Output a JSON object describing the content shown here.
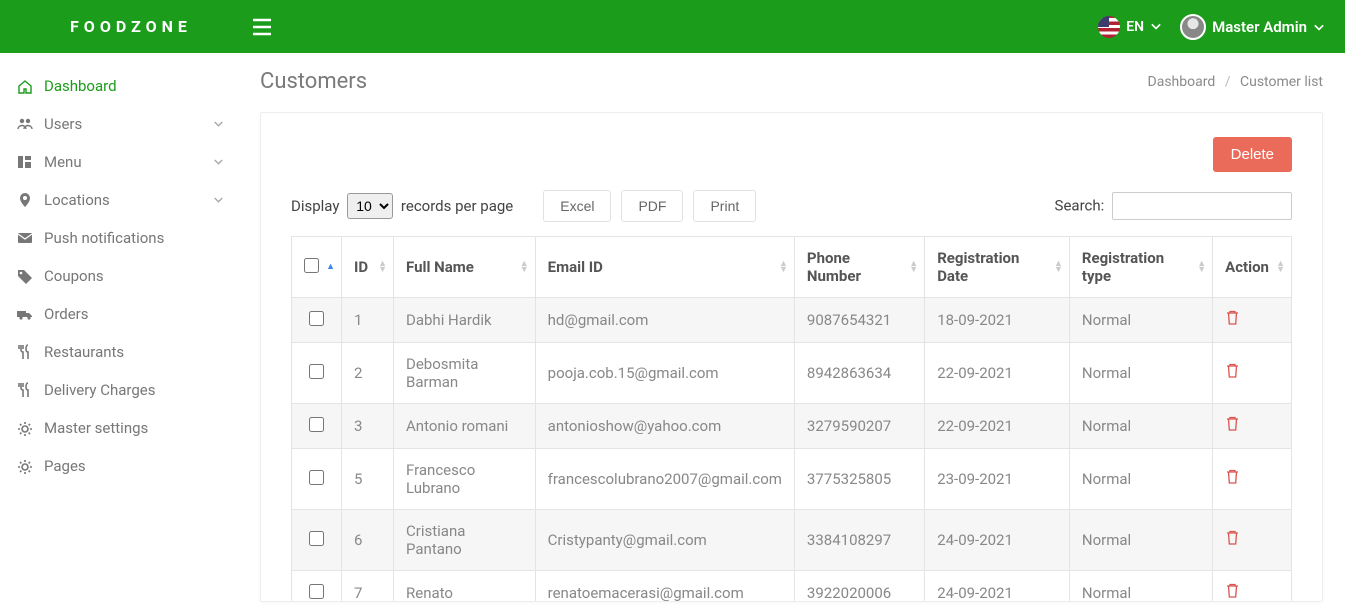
{
  "brand": "FOODZONE",
  "header": {
    "language": "EN",
    "user": "Master Admin"
  },
  "sidebar": {
    "items": [
      {
        "label": "Dashboard",
        "icon": "home",
        "active": true,
        "expandable": false
      },
      {
        "label": "Users",
        "icon": "users",
        "expandable": true
      },
      {
        "label": "Menu",
        "icon": "menu",
        "expandable": true
      },
      {
        "label": "Locations",
        "icon": "pin",
        "expandable": true
      },
      {
        "label": "Push notifications",
        "icon": "mail",
        "expandable": false
      },
      {
        "label": "Coupons",
        "icon": "tag",
        "expandable": false
      },
      {
        "label": "Orders",
        "icon": "truck",
        "expandable": false
      },
      {
        "label": "Restaurants",
        "icon": "fork",
        "expandable": false
      },
      {
        "label": "Delivery Charges",
        "icon": "fork",
        "expandable": false
      },
      {
        "label": "Master settings",
        "icon": "gear",
        "expandable": false
      },
      {
        "label": "Pages",
        "icon": "gear",
        "expandable": false
      }
    ]
  },
  "page": {
    "title": "Customers",
    "breadcrumb": {
      "root": "Dashboard",
      "current": "Customer list"
    }
  },
  "toolbar": {
    "delete": "Delete",
    "display_prefix": "Display",
    "display_suffix": "records per page",
    "page_size": "10",
    "excel": "Excel",
    "pdf": "PDF",
    "print": "Print",
    "search_label": "Search:"
  },
  "table": {
    "columns": {
      "id": "ID",
      "full_name": "Full Name",
      "email": "Email ID",
      "phone": "Phone Number",
      "reg_date": "Registration Date",
      "reg_type": "Registration type",
      "action": "Action"
    },
    "rows": [
      {
        "id": "1",
        "name": "Dabhi Hardik",
        "email": "hd@gmail.com",
        "phone": "9087654321",
        "date": "18-09-2021",
        "type": "Normal"
      },
      {
        "id": "2",
        "name": "Debosmita Barman",
        "email": "pooja.cob.15@gmail.com",
        "phone": "8942863634",
        "date": "22-09-2021",
        "type": "Normal"
      },
      {
        "id": "3",
        "name": "Antonio romani",
        "email": "antonioshow@yahoo.com",
        "phone": "3279590207",
        "date": "22-09-2021",
        "type": "Normal"
      },
      {
        "id": "5",
        "name": "Francesco Lubrano",
        "email": "francescolubrano2007@gmail.com",
        "phone": "3775325805",
        "date": "23-09-2021",
        "type": "Normal"
      },
      {
        "id": "6",
        "name": "Cristiana Pantano",
        "email": "Cristypanty@gmail.com",
        "phone": "3384108297",
        "date": "24-09-2021",
        "type": "Normal"
      },
      {
        "id": "7",
        "name": "Renato",
        "email": "renatoemacerasi@gmail.com",
        "phone": "3922020006",
        "date": "24-09-2021",
        "type": "Normal"
      }
    ]
  }
}
